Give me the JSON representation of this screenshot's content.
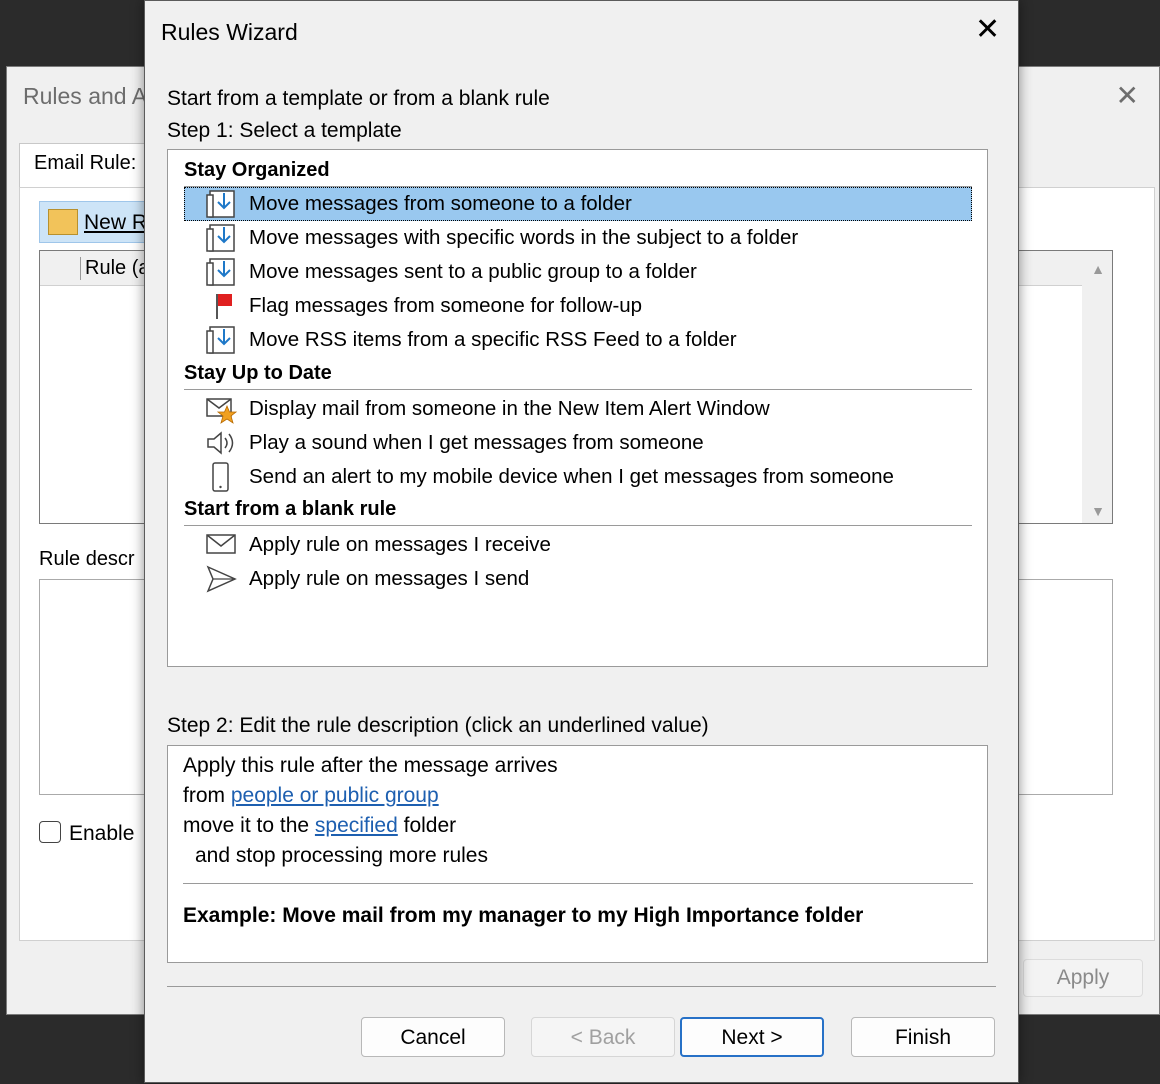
{
  "background_window": {
    "title": "Rules and A",
    "close_glyph": "✕",
    "tab_label": "Email Rule:",
    "new_rule_label": "New R",
    "column_header": "Rule (a",
    "desc_label": "Rule descr",
    "enable_label": "Enable",
    "apply_label": "Apply"
  },
  "dialog": {
    "title": "Rules Wizard",
    "close_glyph": "✕",
    "intro": "Start from a template or from a blank rule",
    "step1_label": "Step 1: Select a template",
    "groups": [
      {
        "title": "Stay Organized",
        "items": [
          {
            "label": "Move messages from someone to a folder",
            "icon": "move-to-folder-icon",
            "selected": true
          },
          {
            "label": "Move messages with specific words in the subject to a folder",
            "icon": "move-to-folder-icon"
          },
          {
            "label": "Move messages sent to a public group to a folder",
            "icon": "move-to-folder-icon"
          },
          {
            "label": "Flag messages from someone for follow-up",
            "icon": "flag-icon"
          },
          {
            "label": "Move RSS items from a specific RSS Feed to a folder",
            "icon": "move-to-folder-icon"
          }
        ]
      },
      {
        "title": "Stay Up to Date",
        "items": [
          {
            "label": "Display mail from someone in the New Item Alert Window",
            "icon": "mail-alert-star-icon"
          },
          {
            "label": "Play a sound when I get messages from someone",
            "icon": "speaker-icon"
          },
          {
            "label": "Send an alert to my mobile device when I get messages from someone",
            "icon": "mobile-device-icon"
          }
        ]
      },
      {
        "title": "Start from a blank rule",
        "items": [
          {
            "label": "Apply rule on messages I receive",
            "icon": "envelope-icon"
          },
          {
            "label": "Apply rule on messages I send",
            "icon": "send-arrow-icon"
          }
        ]
      }
    ],
    "step2_label": "Step 2: Edit the rule description (click an underlined value)",
    "description": {
      "line1": "Apply this rule after the message arrives",
      "line2_prefix": "from ",
      "line2_link": "people or public group",
      "line3_prefix": "move it to the ",
      "line3_link": "specified",
      "line3_suffix": " folder",
      "line4": "and stop processing more rules",
      "example": "Example: Move mail from my manager to my High Importance folder"
    },
    "buttons": {
      "cancel": "Cancel",
      "back": "< Back",
      "next": "Next >",
      "finish": "Finish"
    }
  },
  "colors": {
    "selection": "#99c8ef",
    "link": "#1d5fb0",
    "default_button_border": "#2771c7",
    "icon_blue": "#1e78c8",
    "flag_red": "#e02020",
    "star_orange": "#f0a020"
  }
}
